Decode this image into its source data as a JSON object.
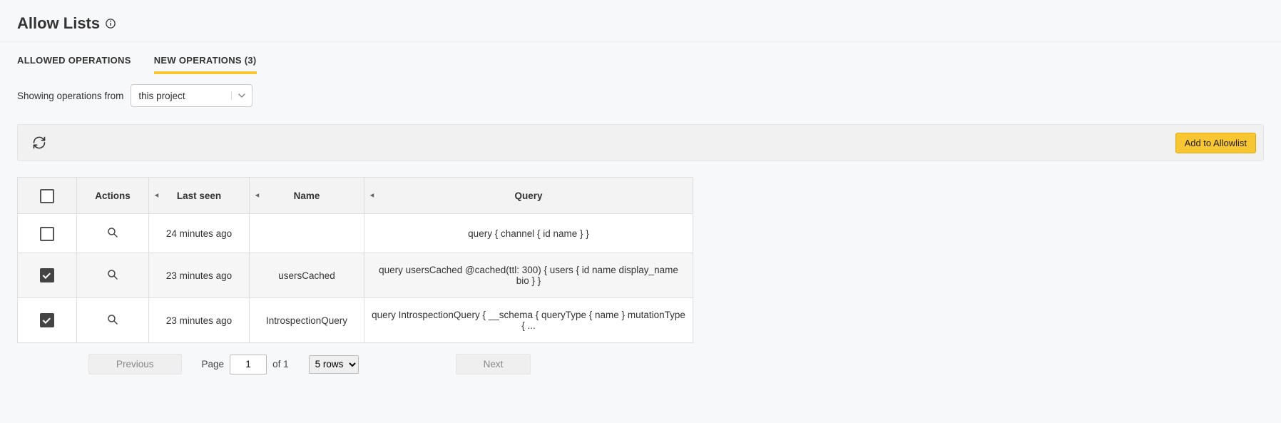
{
  "page_title": "Allow Lists",
  "tabs": {
    "allowed": "ALLOWED OPERATIONS",
    "new": "NEW OPERATIONS (3)"
  },
  "filter": {
    "label": "Showing operations from",
    "selected": "this project"
  },
  "actionbar": {
    "add_btn": "Add to Allowlist"
  },
  "table": {
    "headers": {
      "actions": "Actions",
      "last_seen": "Last seen",
      "name": "Name",
      "query": "Query"
    },
    "rows": [
      {
        "checked": false,
        "last_seen": "24 minutes ago",
        "name": "",
        "query": "query { channel { id name } }"
      },
      {
        "checked": true,
        "last_seen": "23 minutes ago",
        "name": "usersCached",
        "query": "query usersCached @cached(ttl: 300) { users { id name display_name bio } }"
      },
      {
        "checked": true,
        "last_seen": "23 minutes ago",
        "name": "IntrospectionQuery",
        "query": "query IntrospectionQuery { __schema { queryType { name } mutationType { ..."
      }
    ]
  },
  "pagination": {
    "prev": "Previous",
    "next": "Next",
    "page_word": "Page",
    "page_number": "1",
    "of_text": "of 1",
    "rows_option": "5 rows"
  }
}
